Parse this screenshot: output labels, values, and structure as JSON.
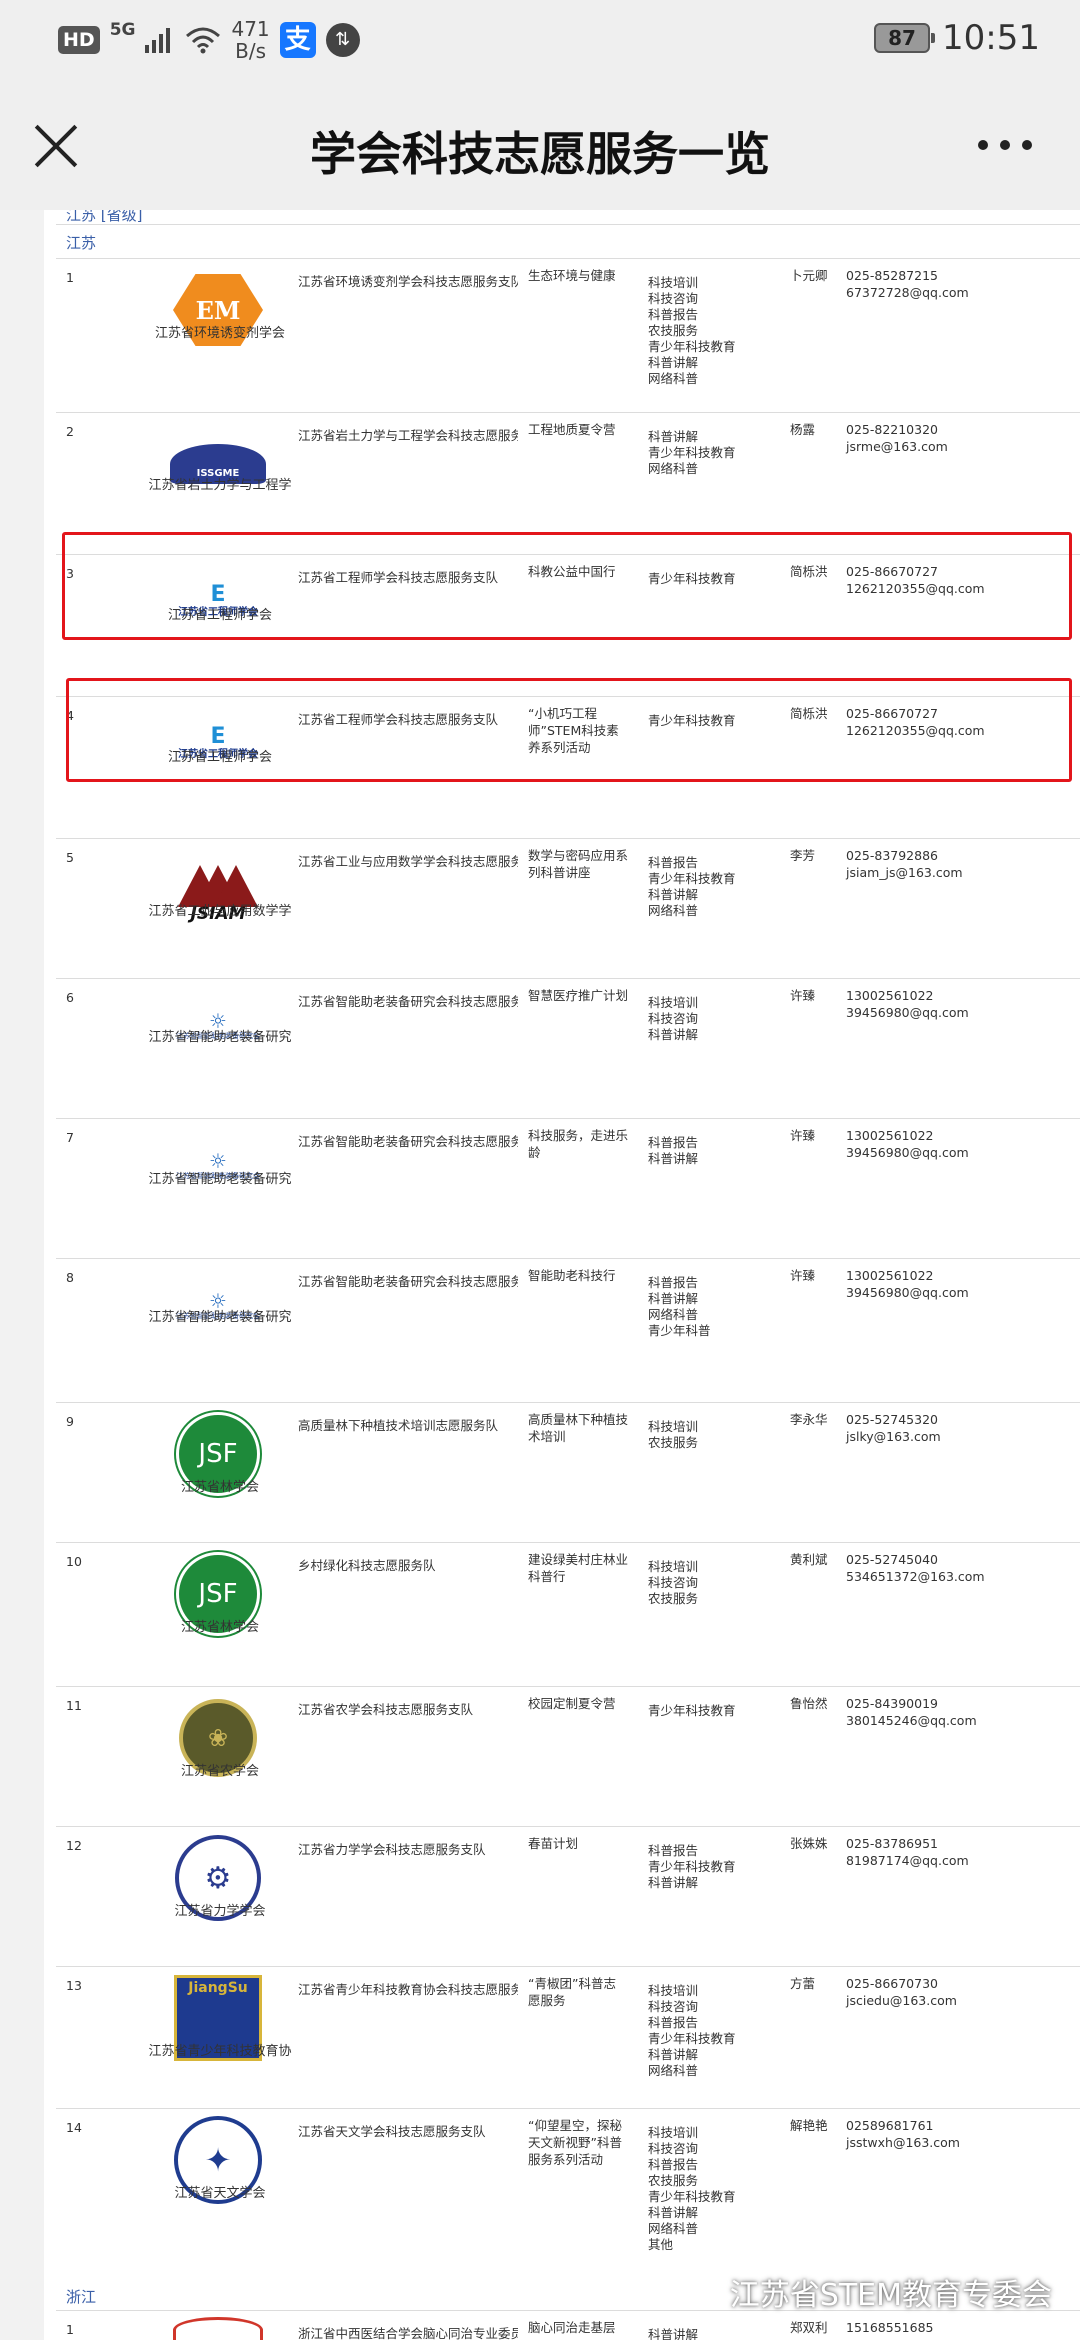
{
  "status_bar": {
    "hd": "HD",
    "network": "5G",
    "speed_value": "471",
    "speed_unit": "B/s",
    "alipay_glyph": "支",
    "badge_glyph": "⇅",
    "battery": "87",
    "time": "10:51"
  },
  "nav": {
    "title": "学会科技志愿服务一览"
  },
  "table": {
    "top_cut_text": "江苏 [省级]",
    "provinces": [
      "江苏",
      "浙江"
    ],
    "rows": [
      {
        "num": "1",
        "org": "江苏省环境诱变剂学会",
        "team": "江苏省环境诱变剂学会科技志愿服务支队",
        "project": "生态环境与健康",
        "types": "科技培训\n科技咨询\n科普报告\n农技服务\n青少年科技教育\n科普讲解\n网络科普",
        "contact": "卜元卿",
        "info": "025-85287215\n67372728@qq.com",
        "logo_text": "EM"
      },
      {
        "num": "2",
        "org": "江苏省岩土力学与工程学",
        "team": "江苏省岩土力学与工程学会科技志愿服务支",
        "project": "工程地质夏令营",
        "types": "科普讲解\n青少年科技教育\n网络科普",
        "contact": "杨露",
        "info": "025-82210320\njsrme@163.com",
        "logo_text": "ISSGME"
      },
      {
        "num": "3",
        "org": "江苏省工程师学会",
        "team": "江苏省工程师学会科技志愿服务支队",
        "project": "科教公益中国行",
        "types": "青少年科技教育",
        "contact": "简栎洪",
        "info": "025-86670727\n1262120355@qq.com",
        "logo_text": "江苏省工程师学会"
      },
      {
        "num": "4",
        "org": "江苏省工程师学会",
        "team": "江苏省工程师学会科技志愿服务支队",
        "project": "“小机巧工程师”STEM科技素养系列活动",
        "types": "青少年科技教育",
        "contact": "简栎洪",
        "info": "025-86670727\n1262120355@qq.com",
        "logo_text": "江苏省工程师学会"
      },
      {
        "num": "5",
        "org": "江苏省工业与应用数学学",
        "team": "江苏省工业与应用数学学会科技志愿服务队",
        "project": "数学与密码应用系列科普讲座",
        "types": "科普报告\n青少年科技教育\n科普讲解\n网络科普",
        "contact": "李芳",
        "info": "025-83792886\njsiam_js@163.com",
        "logo_text": "JSIAM"
      },
      {
        "num": "6",
        "org": "江苏省智能助老装备研究",
        "team": "江苏省智能助老装备研究会科技志愿服务队",
        "project": "智慧医疗推广计划",
        "types": "科技培训\n科技咨询\n科普讲解",
        "contact": "许臻",
        "info": "13002561022\n39456980@qq.com",
        "logo_text": "江苏省智能助老装备研究会"
      },
      {
        "num": "7",
        "org": "江苏省智能助老装备研究",
        "team": "江苏省智能助老装备研究会科技志愿服务队",
        "project": "科技服务，走进乐龄",
        "types": "科普报告\n科普讲解",
        "contact": "许臻",
        "info": "13002561022\n39456980@qq.com",
        "logo_text": "江苏省智能助老装备研究会"
      },
      {
        "num": "8",
        "org": "江苏省智能助老装备研究",
        "team": "江苏省智能助老装备研究会科技志愿服务队",
        "project": "智能助老科技行",
        "types": "科普报告\n科普讲解\n网络科普\n青少年科普",
        "contact": "许臻",
        "info": "13002561022\n39456980@qq.com",
        "logo_text": "江苏省智能助老装备研究会"
      },
      {
        "num": "9",
        "org": "江苏省林学会",
        "team": "高质量林下种植技术培训志愿服务队",
        "project": "高质量林下种植技术培训",
        "types": "科技培训\n农技服务",
        "contact": "李永华",
        "info": "025-52745320\njslky@163.com",
        "logo_text": "JSF"
      },
      {
        "num": "10",
        "org": "江苏省林学会",
        "team": "乡村绿化科技志愿服务队",
        "project": "建设绿美村庄林业科普行",
        "types": "科技培训\n科技咨询\n农技服务",
        "contact": "黄利斌",
        "info": "025-52745040\n534651372@163.com",
        "logo_text": "JSF"
      },
      {
        "num": "11",
        "org": "江苏省农学会",
        "team": "江苏省农学会科技志愿服务支队",
        "project": "校园定制夏令营",
        "types": "青少年科技教育",
        "contact": "鲁怡然",
        "info": "025-84390019\n380145246@qq.com",
        "logo_text": ""
      },
      {
        "num": "12",
        "org": "江苏省力学学会",
        "team": "江苏省力学学会科技志愿服务支队",
        "project": "春苗计划",
        "types": "科普报告\n青少年科技教育\n科普讲解",
        "contact": "张姝姝",
        "info": "025-83786951\n81987174@qq.com",
        "logo_text": ""
      },
      {
        "num": "13",
        "org": "江苏省青少年科技教育协",
        "team": "江苏省青少年科技教育协会科技志愿服务",
        "project": "“青椒团”科普志愿服务",
        "types": "科技培训\n科技咨询\n科普报告\n青少年科技教育\n科普讲解\n网络科普",
        "contact": "方蕾",
        "info": "025-86670730\njsciedu@163.com",
        "logo_text": "JiangSu"
      },
      {
        "num": "14",
        "org": "江苏省天文学会",
        "team": "江苏省天文学会科技志愿服务支队",
        "project": "“仰望星空，探秘天文新视野”科普服务系列活动",
        "types": "科技培训\n科技咨询\n科普报告\n农技服务\n青少年科技教育\n科普讲解\n网络科普\n其他",
        "contact": "解艳艳",
        "info": "02589681761\njsstwxh@163.com",
        "logo_text": ""
      },
      {
        "num": "1",
        "org": "",
        "team": "浙江省中西医结合学会脑心同治专业委员",
        "project": "脑心同治走基层",
        "types": "科普讲解",
        "contact": "郑双利",
        "info": "15168551685",
        "logo_text": ""
      }
    ]
  },
  "watermark": {
    "text": "江苏省STEM教育专委会"
  },
  "icons": {
    "close": "close-icon",
    "more": "more-icon",
    "wechat": "wechat-icon",
    "wifi": "wifi-icon",
    "signal": "signal-icon"
  },
  "colors": {
    "highlight": "#e3151b",
    "province_text": "#3a5fa8"
  }
}
